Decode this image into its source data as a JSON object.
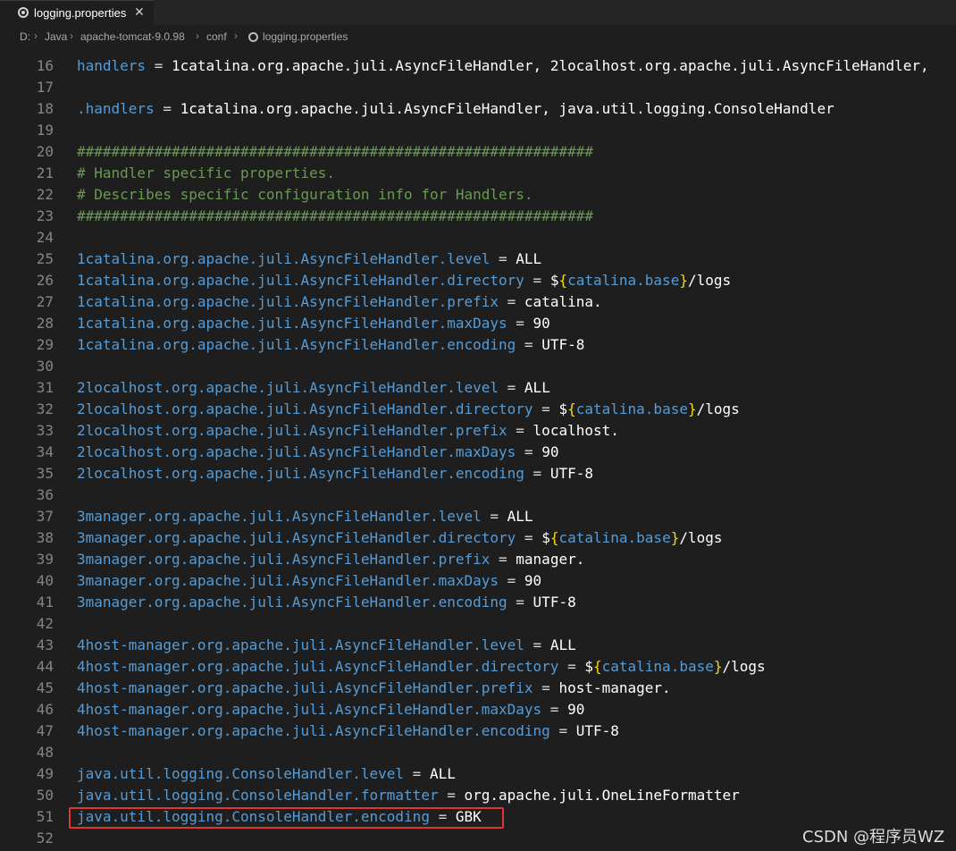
{
  "tab": {
    "title": "logging.properties",
    "close_glyph": "✕",
    "icon": "gear-icon"
  },
  "breadcrumb": {
    "items": [
      "D:",
      "Java",
      "apache-tomcat-9.0.98",
      "conf",
      "logging.properties"
    ],
    "separator": "›"
  },
  "editor": {
    "colors": {
      "key": "#569cd6",
      "comment": "#6a9955",
      "value": "#ffffff",
      "brace": "#ffd700",
      "line_number": "#858585",
      "highlight_border": "#e03535"
    },
    "lines": [
      {
        "n": "16",
        "key": "handlers",
        "op": " = ",
        "val": "1catalina.org.apache.juli.AsyncFileHandler, 2localhost.org.apache.juli.AsyncFileHandler,"
      },
      {
        "n": "17"
      },
      {
        "n": "18",
        "key": ".handlers",
        "op": " = ",
        "val": "1catalina.org.apache.juli.AsyncFileHandler, java.util.logging.ConsoleHandler"
      },
      {
        "n": "19"
      },
      {
        "n": "20",
        "comment": "############################################################"
      },
      {
        "n": "21",
        "comment": "# Handler specific properties."
      },
      {
        "n": "22",
        "comment": "# Describes specific configuration info for Handlers."
      },
      {
        "n": "23",
        "comment": "############################################################"
      },
      {
        "n": "24"
      },
      {
        "n": "25",
        "key": "1catalina.org.apache.juli.AsyncFileHandler.level",
        "op": " = ",
        "val": "ALL"
      },
      {
        "n": "26",
        "key": "1catalina.org.apache.juli.AsyncFileHandler.directory",
        "op": " = ",
        "pre": "$",
        "brace_open": "{",
        "inner": "catalina.base",
        "brace_close": "}",
        "post": "/logs"
      },
      {
        "n": "27",
        "key": "1catalina.org.apache.juli.AsyncFileHandler.prefix",
        "op": " = ",
        "val": "catalina."
      },
      {
        "n": "28",
        "key": "1catalina.org.apache.juli.AsyncFileHandler.maxDays",
        "op": " = ",
        "val": "90"
      },
      {
        "n": "29",
        "key": "1catalina.org.apache.juli.AsyncFileHandler.encoding",
        "op": " = ",
        "val": "UTF-8"
      },
      {
        "n": "30"
      },
      {
        "n": "31",
        "key": "2localhost.org.apache.juli.AsyncFileHandler.level",
        "op": " = ",
        "val": "ALL"
      },
      {
        "n": "32",
        "key": "2localhost.org.apache.juli.AsyncFileHandler.directory",
        "op": " = ",
        "pre": "$",
        "brace_open": "{",
        "inner": "catalina.base",
        "brace_close": "}",
        "post": "/logs"
      },
      {
        "n": "33",
        "key": "2localhost.org.apache.juli.AsyncFileHandler.prefix",
        "op": " = ",
        "val": "localhost."
      },
      {
        "n": "34",
        "key": "2localhost.org.apache.juli.AsyncFileHandler.maxDays",
        "op": " = ",
        "val": "90"
      },
      {
        "n": "35",
        "key": "2localhost.org.apache.juli.AsyncFileHandler.encoding",
        "op": " = ",
        "val": "UTF-8"
      },
      {
        "n": "36"
      },
      {
        "n": "37",
        "key": "3manager.org.apache.juli.AsyncFileHandler.level",
        "op": " = ",
        "val": "ALL"
      },
      {
        "n": "38",
        "key": "3manager.org.apache.juli.AsyncFileHandler.directory",
        "op": " = ",
        "pre": "$",
        "brace_open": "{",
        "inner": "catalina.base",
        "brace_close": "}",
        "post": "/logs"
      },
      {
        "n": "39",
        "key": "3manager.org.apache.juli.AsyncFileHandler.prefix",
        "op": " = ",
        "val": "manager."
      },
      {
        "n": "40",
        "key": "3manager.org.apache.juli.AsyncFileHandler.maxDays",
        "op": " = ",
        "val": "90"
      },
      {
        "n": "41",
        "key": "3manager.org.apache.juli.AsyncFileHandler.encoding",
        "op": " = ",
        "val": "UTF-8"
      },
      {
        "n": "42"
      },
      {
        "n": "43",
        "key": "4host-manager.org.apache.juli.AsyncFileHandler.level",
        "op": " = ",
        "val": "ALL"
      },
      {
        "n": "44",
        "key": "4host-manager.org.apache.juli.AsyncFileHandler.directory",
        "op": " = ",
        "pre": "$",
        "brace_open": "{",
        "inner": "catalina.base",
        "brace_close": "}",
        "post": "/logs"
      },
      {
        "n": "45",
        "key": "4host-manager.org.apache.juli.AsyncFileHandler.prefix",
        "op": " = ",
        "val": "host-manager."
      },
      {
        "n": "46",
        "key": "4host-manager.org.apache.juli.AsyncFileHandler.maxDays",
        "op": " = ",
        "val": "90"
      },
      {
        "n": "47",
        "key": "4host-manager.org.apache.juli.AsyncFileHandler.encoding",
        "op": " = ",
        "val": "UTF-8"
      },
      {
        "n": "48"
      },
      {
        "n": "49",
        "key": "java.util.logging.ConsoleHandler.level",
        "op": " = ",
        "val": "ALL"
      },
      {
        "n": "50",
        "key": "java.util.logging.ConsoleHandler.formatter",
        "op": " = ",
        "val": "org.apache.juli.OneLineFormatter"
      },
      {
        "n": "51",
        "key": "java.util.logging.ConsoleHandler.encoding",
        "op": " = ",
        "val": "GBK",
        "highlighted": true
      },
      {
        "n": "52"
      }
    ]
  },
  "watermark": "CSDN @程序员WZ"
}
